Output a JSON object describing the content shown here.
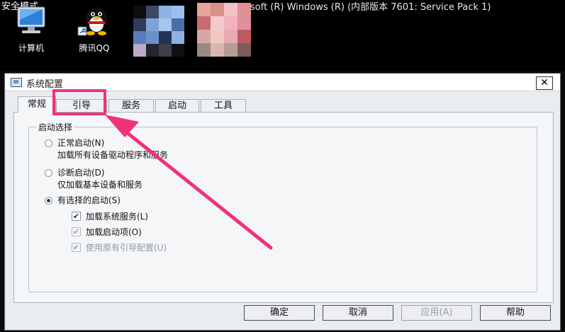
{
  "desktop": {
    "safe_mode_text": "安全模式",
    "windows_version_text": "Microsoft (R) Windows (R) (内部版本 7601: Service Pack 1)",
    "icons": [
      {
        "label": "计算机",
        "icon": "computer-icon"
      },
      {
        "label": "腾讯QQ",
        "icon": "qq-penguin-icon"
      }
    ]
  },
  "dialog": {
    "title": "系统配置",
    "close_label": "✕",
    "tabs": [
      {
        "label": "常规",
        "active": true
      },
      {
        "label": "引导",
        "active": false,
        "highlighted": true
      },
      {
        "label": "服务",
        "active": false
      },
      {
        "label": "启动",
        "active": false
      },
      {
        "label": "工具",
        "active": false
      }
    ],
    "startup_group": {
      "legend": "启动选择",
      "options": [
        {
          "label": "正常启动(N)",
          "description": "加载所有设备驱动程序和服务",
          "selected": false
        },
        {
          "label": "诊断启动(D)",
          "description": "仅加载基本设备和服务",
          "selected": false
        },
        {
          "label": "有选择的启动(S)",
          "selected": true
        }
      ],
      "checkboxes": [
        {
          "label": "加载系统服务(L)",
          "checked": true,
          "enabled": true
        },
        {
          "label": "加载启动项(O)",
          "checked": true,
          "enabled": true
        },
        {
          "label": "使用原有引导配置(U)",
          "checked": true,
          "enabled": false
        }
      ]
    },
    "buttons": {
      "ok": "确定",
      "cancel": "取消",
      "apply": "应用(A)",
      "help": "帮助"
    }
  },
  "colors": {
    "highlight": "#f0327a",
    "dialog_bg": "#e9ecf1",
    "desktop_bg": "#000000"
  }
}
